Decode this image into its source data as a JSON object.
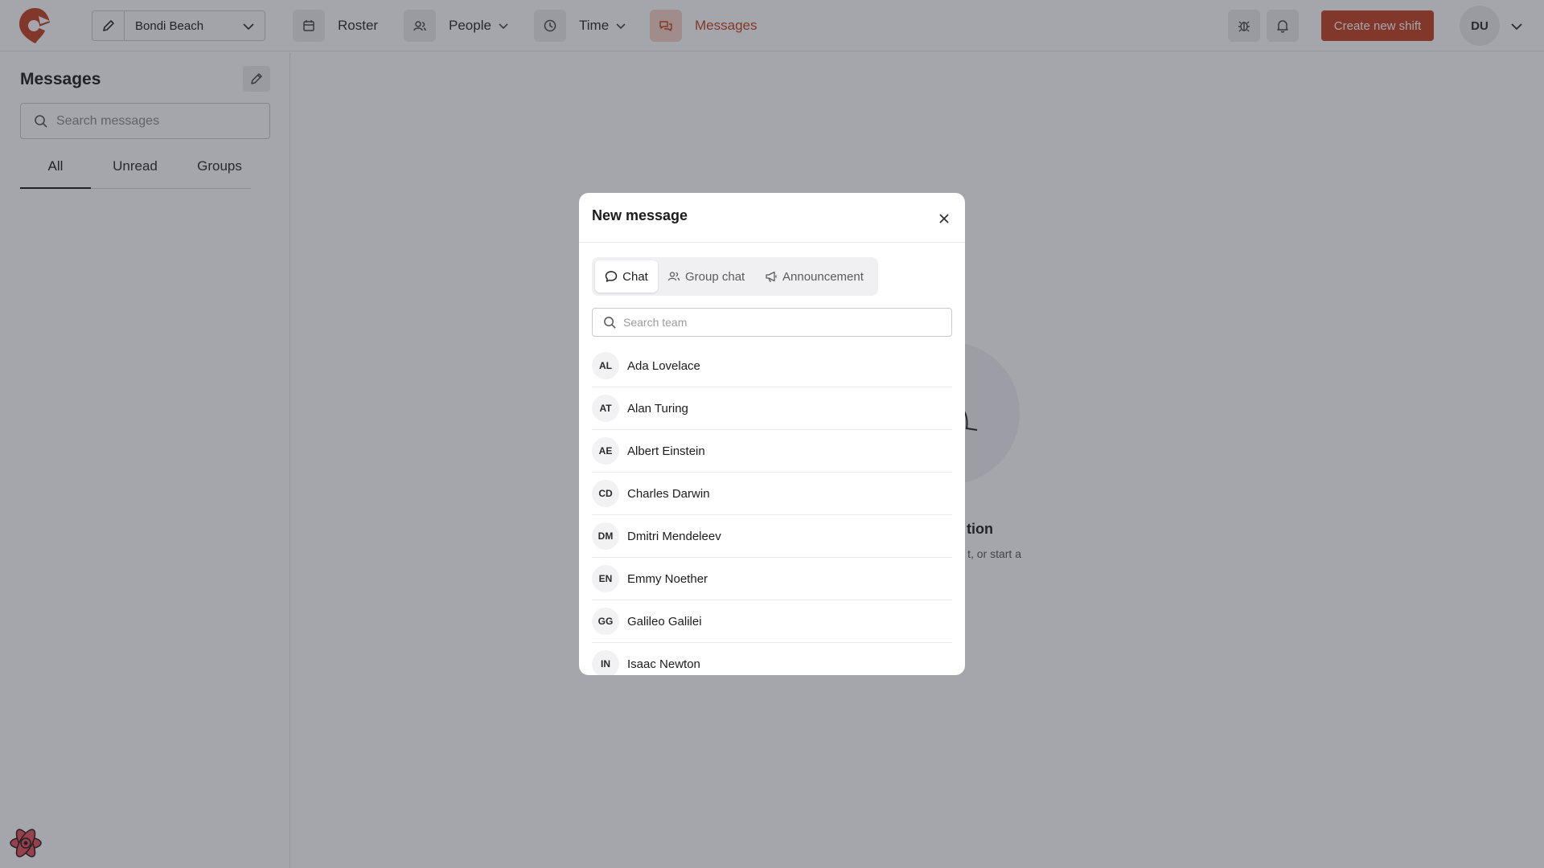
{
  "topbar": {
    "location": "Bondi Beach",
    "nav": [
      {
        "label": "Roster",
        "icon": "calendar-icon"
      },
      {
        "label": "People",
        "icon": "people-icon"
      },
      {
        "label": "Time",
        "icon": "clock-icon"
      },
      {
        "label": "Messages",
        "icon": "chat-icon"
      }
    ],
    "create_shift": "Create new shift",
    "user_initials": "DU"
  },
  "sidebar": {
    "title": "Messages",
    "search_placeholder": "Search messages",
    "tabs": [
      "All",
      "Unread",
      "Groups"
    ],
    "active_tab": "All"
  },
  "empty_state": {
    "title": "tion",
    "subtitle": "t, or start a"
  },
  "modal": {
    "title": "New message",
    "types": [
      "Chat",
      "Group chat",
      "Announcement"
    ],
    "active_type": "Chat",
    "search_placeholder": "Search team",
    "people": [
      {
        "initials": "AL",
        "name": "Ada Lovelace"
      },
      {
        "initials": "AT",
        "name": "Alan Turing"
      },
      {
        "initials": "AE",
        "name": "Albert Einstein"
      },
      {
        "initials": "CD",
        "name": "Charles Darwin"
      },
      {
        "initials": "DM",
        "name": "Dmitri Mendeleev"
      },
      {
        "initials": "EN",
        "name": "Emmy Noether"
      },
      {
        "initials": "GG",
        "name": "Galileo Galilei"
      },
      {
        "initials": "IN",
        "name": "Isaac Newton"
      }
    ]
  },
  "colors": {
    "accent": "#c2401f",
    "accent_light": "#f4d2c8"
  }
}
